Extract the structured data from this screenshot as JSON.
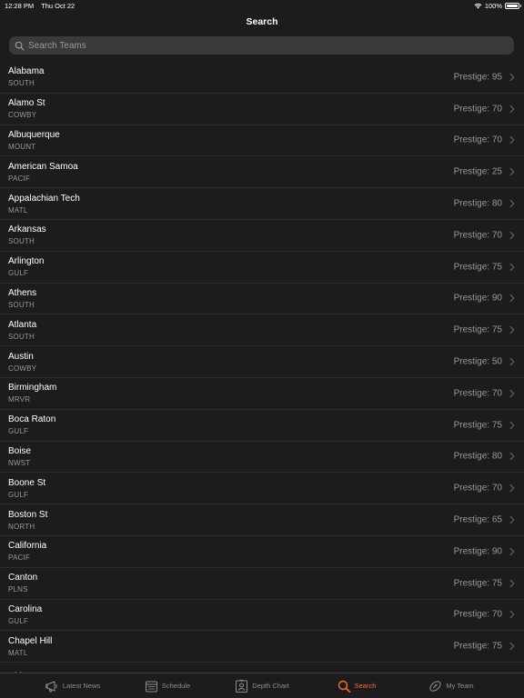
{
  "status_bar": {
    "time": "12:28 PM",
    "date": "Thu Oct 22",
    "battery": "100%"
  },
  "nav": {
    "title": "Search"
  },
  "search": {
    "placeholder": "Search Teams"
  },
  "teams": [
    {
      "name": "Alabama",
      "conference": "SOUTH",
      "prestige": "Prestige: 95"
    },
    {
      "name": "Alamo St",
      "conference": "COWBY",
      "prestige": "Prestige: 70"
    },
    {
      "name": "Albuquerque",
      "conference": "MOUNT",
      "prestige": "Prestige: 70"
    },
    {
      "name": "American Samoa",
      "conference": "PACIF",
      "prestige": "Prestige: 25"
    },
    {
      "name": "Appalachian Tech",
      "conference": "MATL",
      "prestige": "Prestige: 80"
    },
    {
      "name": "Arkansas",
      "conference": "SOUTH",
      "prestige": "Prestige: 70"
    },
    {
      "name": "Arlington",
      "conference": "GULF",
      "prestige": "Prestige: 75"
    },
    {
      "name": "Athens",
      "conference": "SOUTH",
      "prestige": "Prestige: 90"
    },
    {
      "name": "Atlanta",
      "conference": "SOUTH",
      "prestige": "Prestige: 75"
    },
    {
      "name": "Austin",
      "conference": "COWBY",
      "prestige": "Prestige: 50"
    },
    {
      "name": "Birmingham",
      "conference": "MRVR",
      "prestige": "Prestige: 70"
    },
    {
      "name": "Boca Raton",
      "conference": "GULF",
      "prestige": "Prestige: 75"
    },
    {
      "name": "Boise",
      "conference": "NWST",
      "prestige": "Prestige: 80"
    },
    {
      "name": "Boone St",
      "conference": "GULF",
      "prestige": "Prestige: 70"
    },
    {
      "name": "Boston St",
      "conference": "NORTH",
      "prestige": "Prestige: 65"
    },
    {
      "name": "California",
      "conference": "PACIF",
      "prestige": "Prestige: 90"
    },
    {
      "name": "Canton",
      "conference": "PLNS",
      "prestige": "Prestige: 75"
    },
    {
      "name": "Carolina",
      "conference": "GULF",
      "prestige": "Prestige: 70"
    },
    {
      "name": "Chapel Hill",
      "conference": "MATL",
      "prestige": "Prestige: 75"
    },
    {
      "name": "Chi",
      "conference": "",
      "prestige": ""
    }
  ],
  "tabs": [
    {
      "label": "Latest News",
      "icon": "megaphone-icon",
      "active": false
    },
    {
      "label": "Schedule",
      "icon": "calendar-icon",
      "active": false
    },
    {
      "label": "Depth Chart",
      "icon": "roster-icon",
      "active": false
    },
    {
      "label": "Search",
      "icon": "search-icon",
      "active": true
    },
    {
      "label": "My Team",
      "icon": "football-icon",
      "active": false
    }
  ],
  "colors": {
    "accent": "#ff6a2b",
    "background": "#1c1c1e",
    "secondary_text": "#98989d"
  }
}
